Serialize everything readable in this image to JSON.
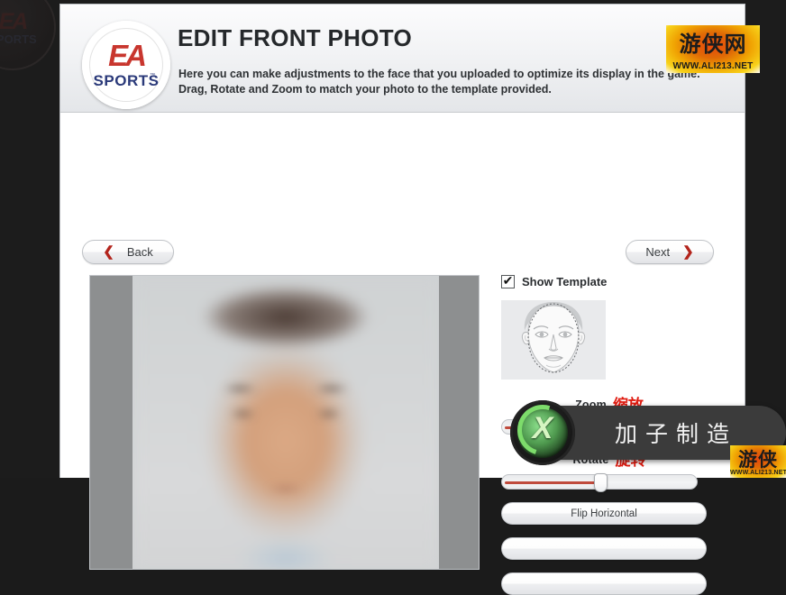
{
  "window": {
    "title": "EDIT FRONT PHOTO",
    "description_line1": "Here you can make adjustments to the face that you uploaded to optimize its display in the game.",
    "description_line2": "Drag, Rotate and Zoom to match your photo to the template provided.",
    "brand": {
      "mark": "EA",
      "sports": "SPORTS",
      "trademark": "™"
    }
  },
  "nav": {
    "back_label": "Back",
    "back_chevron": "❮",
    "next_label": "Next",
    "next_chevron": "❯"
  },
  "controls": {
    "show_template_label": "Show Template",
    "show_template_checked": true,
    "sliders": [
      {
        "name": "zoom",
        "label_en": "Zoom",
        "label_cn": "缩放",
        "value_percent": 72
      },
      {
        "name": "rotate",
        "label_en": "Rotate",
        "label_cn": "旋转",
        "value_percent": 50
      }
    ],
    "buttons": [
      {
        "name": "flip-horizontal",
        "label": "Flip Horizontal"
      },
      {
        "name": "secondary-action-1",
        "label": ""
      },
      {
        "name": "secondary-action-2",
        "label": ""
      }
    ]
  },
  "overlay": {
    "xbox_text": "加子制造",
    "xbox_glyph": "X"
  },
  "watermarks": [
    {
      "name": "watermark-top",
      "chinese": "游侠网",
      "url": "WWW.ALI213.NET"
    },
    {
      "name": "watermark-bottom",
      "chinese": "游侠网",
      "url": "WWW.ALI213.NET"
    }
  ],
  "colors": {
    "accent_red": "#b3241c",
    "brand_red": "#c8362e",
    "brand_blue": "#2b3a7a",
    "cn_label_red": "#e01b10",
    "slider_fill": "#bf4a3c"
  }
}
